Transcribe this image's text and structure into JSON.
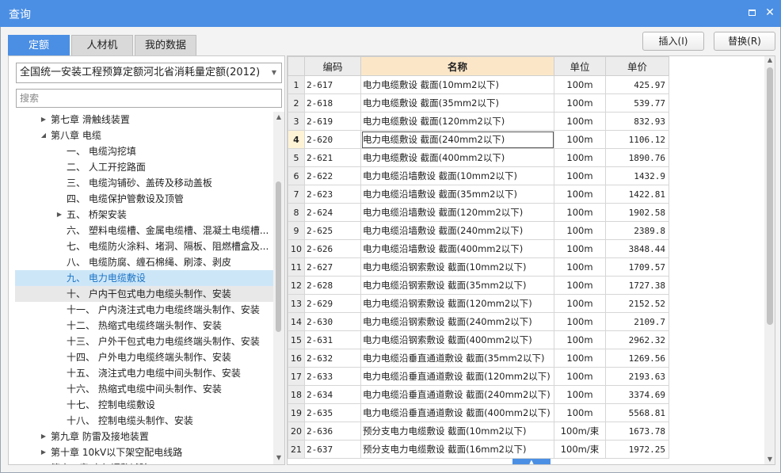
{
  "window": {
    "title": "查询"
  },
  "tabs": [
    {
      "label": "定额",
      "active": true
    },
    {
      "label": "人材机",
      "active": false
    },
    {
      "label": "我的数据",
      "active": false
    }
  ],
  "toolbar": {
    "insert_label": "插入(I)",
    "replace_label": "替换(R)"
  },
  "left": {
    "library": "全国统一安装工程预算定额河北省消耗量定额(2012)",
    "search_placeholder": "搜索",
    "tree": [
      {
        "label": "第七章 滑触线装置",
        "level": 1,
        "toggle": "collapsed"
      },
      {
        "label": "第八章 电缆",
        "level": 1,
        "toggle": "expanded"
      },
      {
        "label": "一、 电缆沟挖填",
        "level": 2,
        "toggle": "none"
      },
      {
        "label": "二、 人工开挖路面",
        "level": 2,
        "toggle": "none"
      },
      {
        "label": "三、 电缆沟铺砂、盖砖及移动盖板",
        "level": 2,
        "toggle": "none"
      },
      {
        "label": "四、 电缆保护管敷设及顶管",
        "level": 2,
        "toggle": "none"
      },
      {
        "label": "五、 桥架安装",
        "level": 2,
        "toggle": "collapsed"
      },
      {
        "label": "六、 塑料电缆槽、金属电缆槽、混凝土电缆槽...",
        "level": 2,
        "toggle": "none"
      },
      {
        "label": "七、 电缆防火涂料、堵洞、隔板、阻燃槽盒及...",
        "level": 2,
        "toggle": "none"
      },
      {
        "label": "八、 电缆防腐、缠石棉绳、刷漆、剥皮",
        "level": 2,
        "toggle": "none"
      },
      {
        "label": "九、 电力电缆敷设",
        "level": 2,
        "toggle": "none",
        "state": "selected"
      },
      {
        "label": "十、 户内干包式电力电缆头制作、安装",
        "level": 2,
        "toggle": "none",
        "state": "hover"
      },
      {
        "label": "十一、 户内浇注式电力电缆终端头制作、安装",
        "level": 2,
        "toggle": "none"
      },
      {
        "label": "十二、 热缩式电缆终端头制作、安装",
        "level": 2,
        "toggle": "none"
      },
      {
        "label": "十三、 户外干包式电力电缆终端头制作、安装",
        "level": 2,
        "toggle": "none"
      },
      {
        "label": "十四、 户外电力电缆终端头制作、安装",
        "level": 2,
        "toggle": "none"
      },
      {
        "label": "十五、 浇注式电力电缆中间头制作、安装",
        "level": 2,
        "toggle": "none"
      },
      {
        "label": "十六、 热缩式电缆中间头制作、安装",
        "level": 2,
        "toggle": "none"
      },
      {
        "label": "十七、 控制电缆敷设",
        "level": 2,
        "toggle": "none"
      },
      {
        "label": "十八、 控制电缆头制作、安装",
        "level": 2,
        "toggle": "none"
      },
      {
        "label": "第九章 防雷及接地装置",
        "level": 1,
        "toggle": "collapsed"
      },
      {
        "label": "第十章 10kV以下架空配电线路",
        "level": 1,
        "toggle": "collapsed"
      },
      {
        "label": "第十一章 电气调整试验",
        "level": 1,
        "toggle": "collapsed"
      }
    ]
  },
  "grid": {
    "headers": {
      "index": "",
      "code": "编码",
      "name": "名称",
      "unit": "单位",
      "price": "单价"
    },
    "current_row": 4,
    "rows": [
      {
        "idx": "1",
        "code": "2-617",
        "name": "电力电缆敷设 截面(10mm2以下)",
        "unit": "100m",
        "price": "425.97"
      },
      {
        "idx": "2",
        "code": "2-618",
        "name": "电力电缆敷设 截面(35mm2以下)",
        "unit": "100m",
        "price": "539.77"
      },
      {
        "idx": "3",
        "code": "2-619",
        "name": "电力电缆敷设 截面(120mm2以下)",
        "unit": "100m",
        "price": "832.93"
      },
      {
        "idx": "4",
        "code": "2-620",
        "name": "电力电缆敷设 截面(240mm2以下)",
        "unit": "100m",
        "price": "1106.12"
      },
      {
        "idx": "5",
        "code": "2-621",
        "name": "电力电缆敷设 截面(400mm2以下)",
        "unit": "100m",
        "price": "1890.76"
      },
      {
        "idx": "6",
        "code": "2-622",
        "name": "电力电缆沿墙敷设 截面(10mm2以下)",
        "unit": "100m",
        "price": "1432.9"
      },
      {
        "idx": "7",
        "code": "2-623",
        "name": "电力电缆沿墙敷设 截面(35mm2以下)",
        "unit": "100m",
        "price": "1422.81"
      },
      {
        "idx": "8",
        "code": "2-624",
        "name": "电力电缆沿墙敷设 截面(120mm2以下)",
        "unit": "100m",
        "price": "1902.58"
      },
      {
        "idx": "9",
        "code": "2-625",
        "name": "电力电缆沿墙敷设 截面(240mm2以下)",
        "unit": "100m",
        "price": "2389.8"
      },
      {
        "idx": "10",
        "code": "2-626",
        "name": "电力电缆沿墙敷设 截面(400mm2以下)",
        "unit": "100m",
        "price": "3848.44"
      },
      {
        "idx": "11",
        "code": "2-627",
        "name": "电力电缆沿钢索敷设 截面(10mm2以下)",
        "unit": "100m",
        "price": "1709.57"
      },
      {
        "idx": "12",
        "code": "2-628",
        "name": "电力电缆沿钢索敷设 截面(35mm2以下)",
        "unit": "100m",
        "price": "1727.38"
      },
      {
        "idx": "13",
        "code": "2-629",
        "name": "电力电缆沿钢索敷设 截面(120mm2以下)",
        "unit": "100m",
        "price": "2152.52"
      },
      {
        "idx": "14",
        "code": "2-630",
        "name": "电力电缆沿钢索敷设 截面(240mm2以下)",
        "unit": "100m",
        "price": "2109.7"
      },
      {
        "idx": "15",
        "code": "2-631",
        "name": "电力电缆沿钢索敷设 截面(400mm2以下)",
        "unit": "100m",
        "price": "2962.32"
      },
      {
        "idx": "16",
        "code": "2-632",
        "name": "电力电缆沿垂直通道敷设 截面(35mm2以下)",
        "unit": "100m",
        "price": "1269.56"
      },
      {
        "idx": "17",
        "code": "2-633",
        "name": "电力电缆沿垂直通道敷设 截面(120mm2以下)",
        "unit": "100m",
        "price": "2193.63"
      },
      {
        "idx": "18",
        "code": "2-634",
        "name": "电力电缆沿垂直通道敷设 截面(240mm2以下)",
        "unit": "100m",
        "price": "3374.69"
      },
      {
        "idx": "19",
        "code": "2-635",
        "name": "电力电缆沿垂直通道敷设 截面(400mm2以下)",
        "unit": "100m",
        "price": "5568.81"
      },
      {
        "idx": "20",
        "code": "2-636",
        "name": "预分支电力电缆敷设 截面(10mm2以下)",
        "unit": "100m/束",
        "price": "1673.78"
      },
      {
        "idx": "21",
        "code": "2-637",
        "name": "预分支电力电缆敷设 截面(16mm2以下)",
        "unit": "100m/束",
        "price": "1972.25"
      }
    ]
  },
  "icons": {
    "maximize": "maximize-icon",
    "close": "close-icon",
    "dropdown": "chevron-down-icon",
    "expanded": "triangle-down-icon",
    "collapsed": "triangle-right-icon"
  },
  "colors": {
    "accent": "#4b8fe4",
    "selected_bg": "#cde6f7",
    "name_header_bg": "#fbe7c8"
  }
}
